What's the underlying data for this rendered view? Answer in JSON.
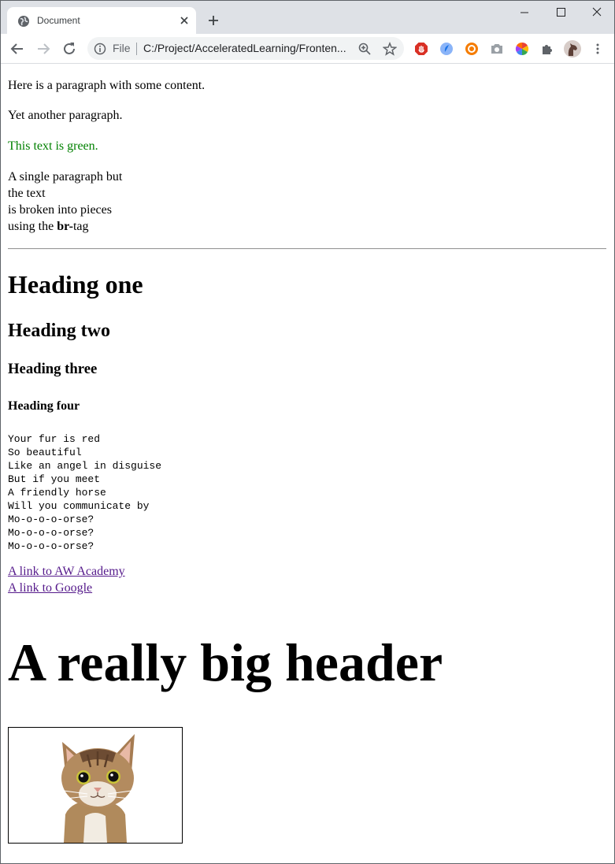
{
  "browser": {
    "tab_title": "Document",
    "omnibox": {
      "scheme": "File",
      "url": "C:/Project/AcceleratedLearning/Fronten..."
    },
    "icons": [
      "globe-icon",
      "close-icon",
      "plus-icon",
      "minimize-icon",
      "maximize-icon",
      "window-close-icon",
      "back-icon",
      "forward-icon",
      "reload-icon",
      "info-icon",
      "zoom-icon",
      "star-icon",
      "adblock-icon",
      "extension-icon",
      "camera-icon",
      "color-wheel-icon",
      "puzzle-icon",
      "profile-avatar",
      "more-icon"
    ]
  },
  "page": {
    "p1": "Here is a paragraph with some content.",
    "p2": "Yet another paragraph.",
    "p3_green": "This text is green.",
    "p4_lines": [
      "A single paragraph but",
      "the text",
      "is broken into pieces",
      "using the "
    ],
    "p4_bold": "br-",
    "p4_end": "tag",
    "h1": "Heading one",
    "h2": "Heading two",
    "h3": "Heading three",
    "h4": "Heading four",
    "poem": "Your fur is red\nSo beautiful\nLike an angel in disguise\nBut if you meet\nA friendly horse\nWill you communicate by\nMo-o-o-o-orse?\nMo-o-o-o-orse?\nMo-o-o-o-orse?",
    "link1": "A link to AW Academy",
    "link2": "A link to Google",
    "big_header": "A really big header",
    "green_color": "#008000",
    "link_color": "#551a8b"
  }
}
